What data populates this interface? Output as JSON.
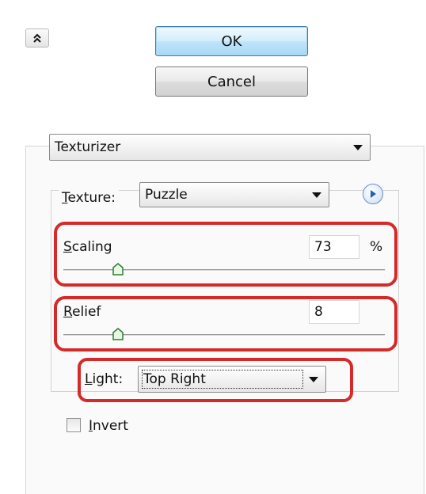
{
  "buttons": {
    "ok_label": "OK",
    "cancel_label": "Cancel"
  },
  "filter": {
    "selected": "Texturizer"
  },
  "texture": {
    "label_first": "T",
    "label_rest": "exture:",
    "selected": "Puzzle"
  },
  "scaling": {
    "label_first": "S",
    "label_rest": "caling",
    "value": "73",
    "unit": "%",
    "slider_fraction": 0.17
  },
  "relief": {
    "label_first": "R",
    "label_rest": "elief",
    "value": "8",
    "slider_fraction": 0.17
  },
  "light": {
    "label_first": "L",
    "label_rest": "ight:",
    "selected": "Top Right"
  },
  "invert": {
    "label_first": "I",
    "label_rest": "nvert",
    "checked": false
  },
  "icons": {
    "collapse": "double-chevron-up-icon",
    "menu_arrow": "circle-arrow-right-icon",
    "dropdown": "triangle-down-icon"
  },
  "colors": {
    "highlight": "#d42a2a",
    "ok_button": "#bfe4fa",
    "accent_arrow": "#1f5fbf"
  }
}
